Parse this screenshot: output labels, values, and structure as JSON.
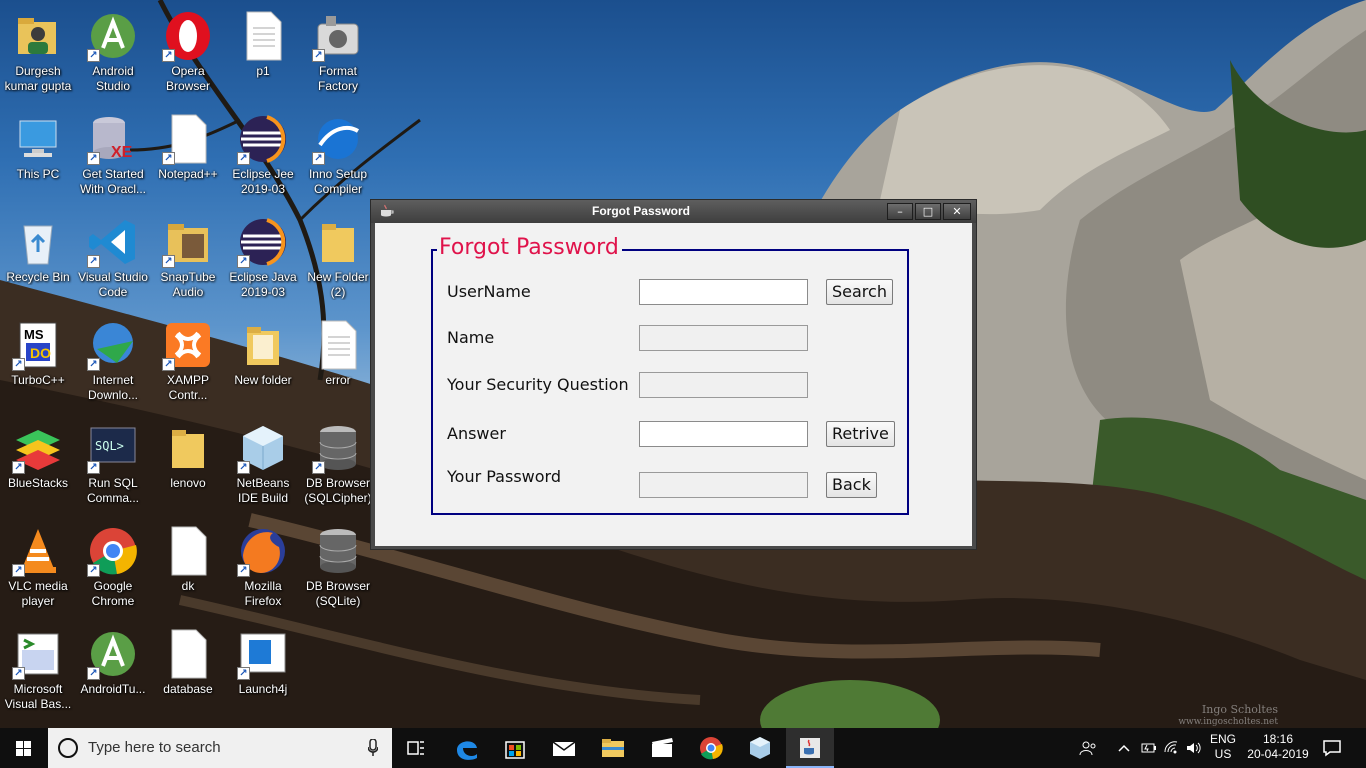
{
  "desktop": {
    "icons": [
      {
        "label": "Durgesh kumar gupta",
        "icon": "user-folder-icon"
      },
      {
        "label": "Android Studio",
        "icon": "android-studio-icon"
      },
      {
        "label": "Opera Browser",
        "icon": "opera-icon"
      },
      {
        "label": "p1",
        "icon": "text-file-icon"
      },
      {
        "label": "Format Factory",
        "icon": "format-factory-icon"
      },
      {
        "label": "This PC",
        "icon": "computer-icon"
      },
      {
        "label": "Get Started With Oracl...",
        "icon": "oracle-db-icon"
      },
      {
        "label": "Notepad++",
        "icon": "file-icon"
      },
      {
        "label": "Eclipse Jee 2019-03",
        "icon": "eclipse-icon"
      },
      {
        "label": "Inno Setup Compiler",
        "icon": "inno-setup-icon"
      },
      {
        "label": "Recycle Bin",
        "icon": "recycle-bin-icon"
      },
      {
        "label": "Visual Studio Code",
        "icon": "vscode-icon"
      },
      {
        "label": "SnapTube Audio",
        "icon": "folder-icon"
      },
      {
        "label": "Eclipse Java 2019-03",
        "icon": "eclipse-icon"
      },
      {
        "label": "New Folder (2)",
        "icon": "folder-icon"
      },
      {
        "label": "TurboC++",
        "icon": "turboc-icon"
      },
      {
        "label": "Internet Downlo...",
        "icon": "idm-icon"
      },
      {
        "label": "XAMPP Contr...",
        "icon": "xampp-icon"
      },
      {
        "label": "New folder",
        "icon": "folder-icon"
      },
      {
        "label": "error",
        "icon": "text-file-icon"
      },
      {
        "label": "BlueStacks",
        "icon": "bluestacks-icon"
      },
      {
        "label": "Run SQL Comma...",
        "icon": "sql-terminal-icon"
      },
      {
        "label": "lenovo",
        "icon": "folder-icon"
      },
      {
        "label": "NetBeans IDE Build 20180...",
        "icon": "netbeans-icon"
      },
      {
        "label": "DB Browser (SQLCipher)",
        "icon": "database-icon"
      },
      {
        "label": "VLC media player",
        "icon": "vlc-icon"
      },
      {
        "label": "Google Chrome",
        "icon": "chrome-icon"
      },
      {
        "label": "dk",
        "icon": "file-icon"
      },
      {
        "label": "Mozilla Firefox",
        "icon": "firefox-icon"
      },
      {
        "label": "DB Browser (SQLite)",
        "icon": "database-icon"
      },
      {
        "label": "Microsoft Visual Bas...",
        "icon": "visual-basic-icon"
      },
      {
        "label": "AndroidTu...",
        "icon": "android-studio-icon"
      },
      {
        "label": "database",
        "icon": "file-icon"
      },
      {
        "label": "Launch4j",
        "icon": "launch4j-icon"
      }
    ],
    "wallpaper_credit": {
      "name": "Ingo Scholtes",
      "site": "www.ingoscholtes.net"
    }
  },
  "window": {
    "title": "Forgot Password",
    "controls": {
      "minimize": "–",
      "maximize": "□",
      "close": "✕"
    },
    "group_title": "Forgot Password",
    "fields": [
      {
        "label": "UserName",
        "value": ""
      },
      {
        "label": "Name",
        "value": ""
      },
      {
        "label": "Your Security Question",
        "value": ""
      },
      {
        "label": "Answer",
        "value": ""
      },
      {
        "label": "Your Password",
        "value": ""
      }
    ],
    "buttons": {
      "search": "Search",
      "retrive": "Retrive",
      "back": "Back"
    },
    "colors": {
      "group_title": "#e0134b",
      "group_border": "#000080"
    }
  },
  "taskbar": {
    "search_placeholder": "Type here to search",
    "apps": [
      "task-view-icon",
      "edge-icon",
      "store-icon",
      "mail-icon",
      "file-explorer-icon",
      "movie-editor-icon",
      "chrome-icon",
      "virtualbox-icon",
      "java-icon"
    ],
    "language": {
      "line1": "ENG",
      "line2": "US"
    },
    "clock": {
      "time": "18:16",
      "date": "20-04-2019"
    }
  }
}
